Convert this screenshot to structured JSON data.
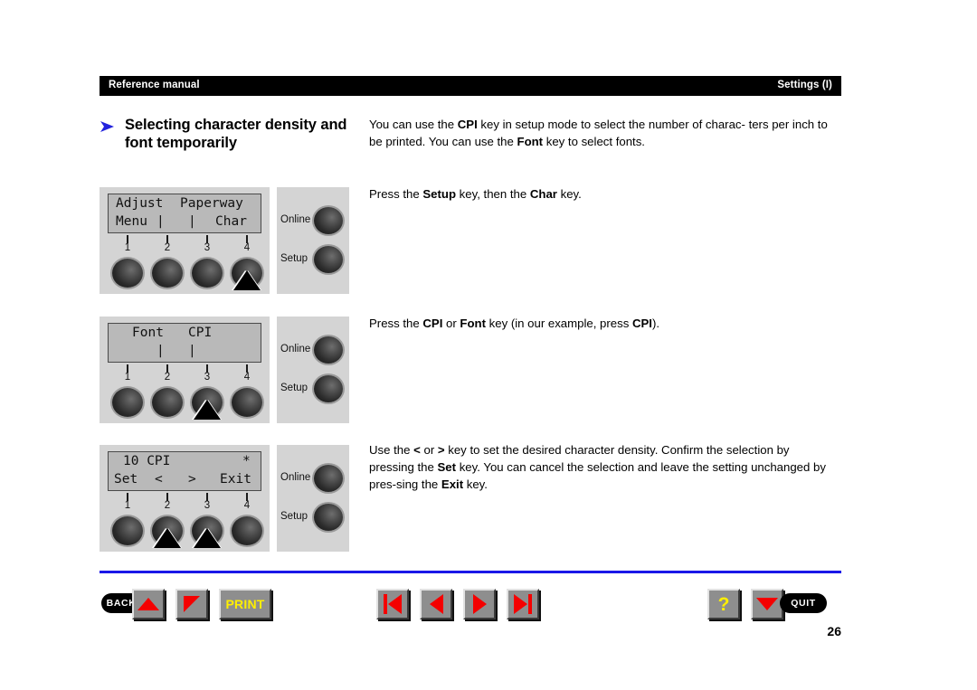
{
  "header": {
    "left_text": "Reference manual",
    "right_text": "Settings (I)"
  },
  "section": {
    "bullet_icon": "blue-triangle-right-icon",
    "title": "Selecting character density and font temporarily",
    "accent_color": "#2222dd"
  },
  "body": {
    "paragraph_1": {
      "line_1_a": "You can use the ",
      "line_1_b": "CPI",
      "line_1_c": " key in setup mode to select the number of charac-",
      "line_2_a": "ters per inch to be printed. You can use the ",
      "line_2_b": "Font",
      "line_2_c": " key to select fonts."
    },
    "paragraph_2": {
      "a": "Press the ",
      "b": "Setup",
      "c": " key, then the ",
      "d": "Char",
      "e": " key."
    },
    "paragraph_3": {
      "a": "Press the ",
      "b": "CPI",
      "c": " or ",
      "d": "Font",
      "e": " key (in our example, press ",
      "f": "CPI",
      "g": ")."
    },
    "paragraph_4": {
      "a": "Use the ",
      "b": "<",
      "c": " or ",
      "d": ">",
      "e": " key to set the desired character density. Confirm the selection by pressing the ",
      "f": "Set",
      "g": " key.",
      "h": "You can cancel the selection and leave the setting unchanged by pres-sing the ",
      "i": "Exit",
      "j": " key."
    }
  },
  "panels": [
    {
      "name": "panel-adjust-paperway",
      "lcd": {
        "row1_left": "Adjust",
        "row1_right": "Paperway",
        "row2_col1": "Menu",
        "row2_col2": "|",
        "row2_col3": "|",
        "row2_col4": "Char"
      },
      "knob_numbers": [
        "1",
        "2",
        "3",
        "4"
      ],
      "pressed_knob": 4,
      "side_labels": [
        "Online",
        "Setup"
      ]
    },
    {
      "name": "panel-font-cpi",
      "lcd": {
        "row1_left": "Font",
        "row1_right": "CPI",
        "row2_col1": "",
        "row2_col2": "|",
        "row2_col3": "|",
        "row2_col4": ""
      },
      "knob_numbers": [
        "1",
        "2",
        "3",
        "4"
      ],
      "pressed_knob": 3,
      "side_labels": [
        "Online",
        "Setup"
      ]
    },
    {
      "name": "panel-10-cpi",
      "lcd": {
        "row1_left": "10 CPI",
        "row1_right": "*",
        "row2_col1": "Set",
        "row2_col2": "<",
        "row2_col3": ">",
        "row2_col4": "Exit"
      },
      "knob_numbers": [
        "1",
        "2",
        "3",
        "4"
      ],
      "pressed_knob": 2,
      "pressed_knob_2": 3,
      "side_labels": [
        "Online",
        "Setup"
      ]
    }
  ],
  "bottom_nav": {
    "back_label": "BACK",
    "print_label": "PRINT",
    "quit_label": "QUIT",
    "help_label": "?",
    "buttons": [
      "scroll-up-button",
      "scroll-down-button",
      "print-button",
      "first-page-button",
      "previous-page-button",
      "next-page-button",
      "last-page-button",
      "help-button",
      "quit-button"
    ],
    "accent_red": "#f40000",
    "accent_yellow": "#ffef00",
    "rule_color": "#1a17e8"
  },
  "page_number": "26"
}
